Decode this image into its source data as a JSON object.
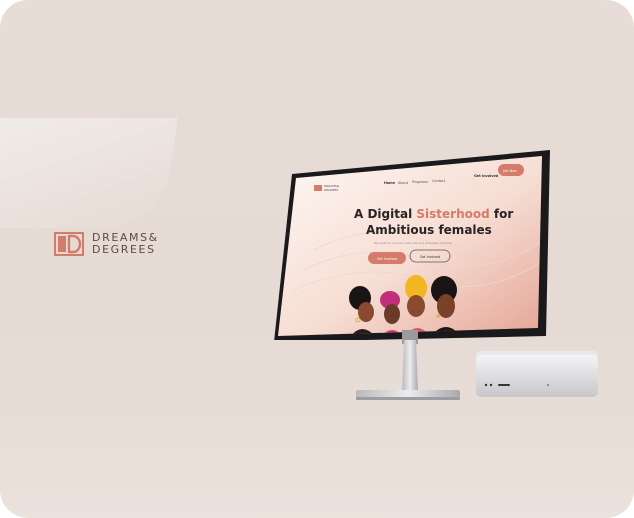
{
  "brand": {
    "line1": "DREAMS&",
    "line2": "DEGREES",
    "color": "#d47b6a"
  },
  "site": {
    "logo_line1": "DREAMS&",
    "logo_line2": "DEGREES",
    "nav": [
      "Home",
      "About",
      "Programs",
      "Contact"
    ],
    "get_involved": "Get Involved",
    "join_button": "Join Now",
    "headline_part1": "A Digital ",
    "headline_accent": "Sisterhood",
    "headline_part2": " for",
    "headline_line2": "Ambitious females",
    "subtitle": "We exist to connect, educate and empower females",
    "cta_primary": "Get Involved",
    "cta_secondary": "Get Involved",
    "accent": "#d47b6a"
  },
  "colors": {
    "background": "#e7dcd6",
    "accent": "#d47b6a",
    "silver": "#c9c9cc"
  }
}
